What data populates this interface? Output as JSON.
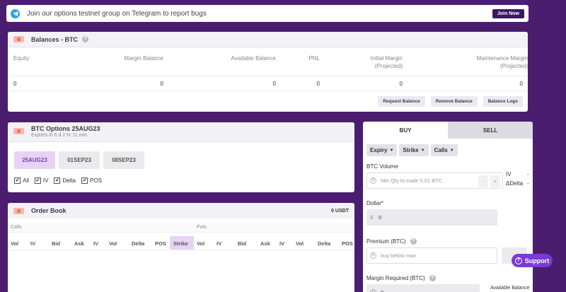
{
  "banner": {
    "text": "Join our options testnet group on Telegram to report bugs",
    "button": "Join Now"
  },
  "balances": {
    "title": "Balances - BTC",
    "headers": [
      "Equity",
      "Margin Balance",
      "Available Balance",
      "PNL",
      "Initial Margin",
      "Maintenance Margin"
    ],
    "header_subs": {
      "initial": "(Projected)",
      "maintenance": "(Projected)"
    },
    "values": [
      "0",
      "0",
      "0",
      "0",
      "0",
      "0"
    ],
    "buttons": [
      "Request Balance",
      "Remove Balance",
      "Balance Logs"
    ]
  },
  "options": {
    "title": "BTC Options 25AUG23",
    "subtitle": "Expires in 6 d 2 hr 11 min",
    "expiries": [
      "25AUG23",
      "01SEP23",
      "08SEP23"
    ],
    "checks": [
      "All",
      "IV",
      "Delta",
      "POS"
    ]
  },
  "orderbook": {
    "title": "Order Book",
    "usdt": "0 USDT",
    "calls": "Calls",
    "puts": "Puts",
    "columns": [
      "Vol",
      "IV",
      "Bid",
      "Ask",
      "IV",
      "Vol",
      "Delta",
      "POS",
      "Strike",
      "Vol",
      "IV",
      "Bid",
      "Ask",
      "IV",
      "Vol",
      "Delta",
      "POS"
    ]
  },
  "trade": {
    "buy": "BUY",
    "sell": "SELL",
    "filters": [
      "Expiry",
      "Strike",
      "Calls"
    ],
    "btc_volume_label": "BTC Volume",
    "btc_volume_placeholder": "Min Qty to trade 0.01 BTC",
    "minus": "-",
    "plus": "+",
    "iv_label": "IV",
    "iv_value": "-",
    "delta_label": "ΔDelta",
    "delta_value": "-",
    "dollar_label": "Dollar*",
    "dollar_symbol": "$",
    "dollar_value": "0",
    "premium_label": "Premium (BTC)",
    "premium_placeholder": "buy below max",
    "margin_label": "Margin Required (BTC)",
    "margin_value": "0",
    "available_label": "Available Balance"
  },
  "support": "Support"
}
